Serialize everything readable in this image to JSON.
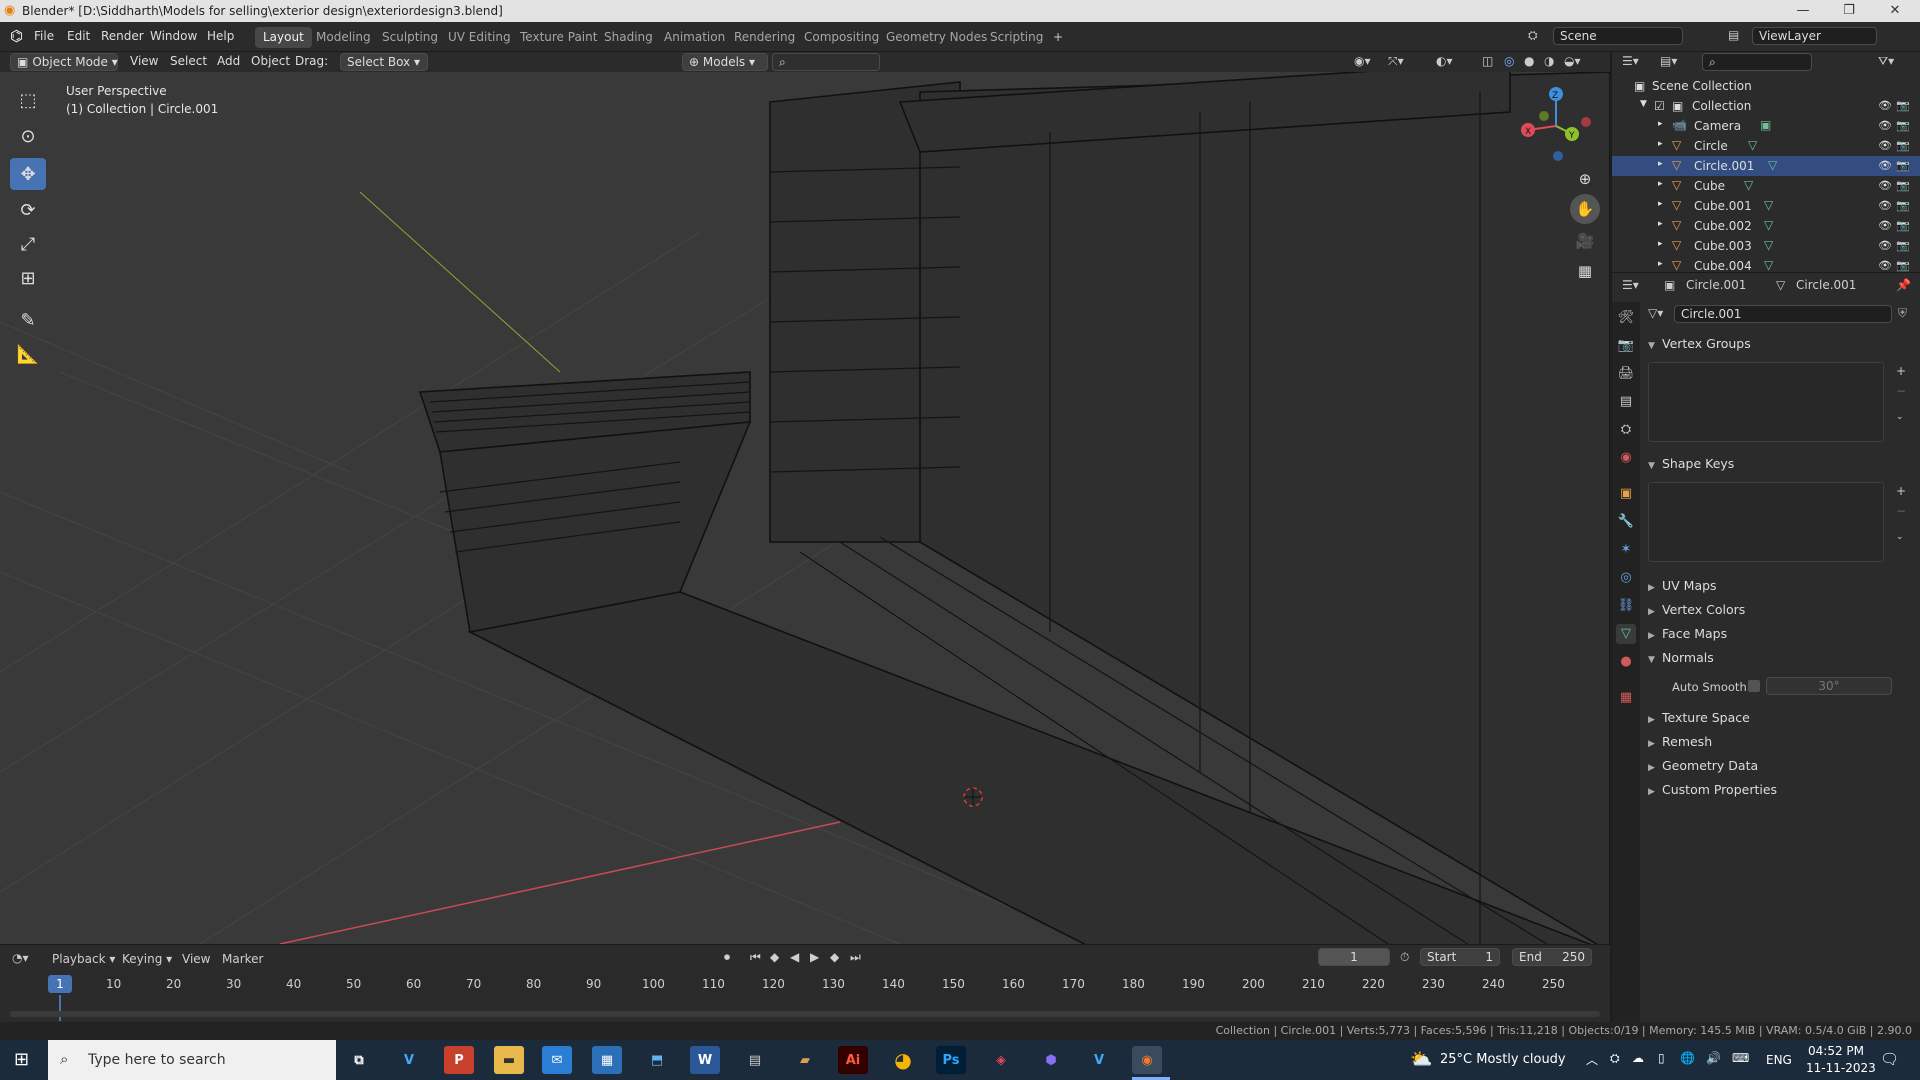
{
  "window": {
    "title": "Blender* [D:\\Siddharth\\Models for selling\\exterior design\\exteriordesign3.blend]",
    "minimize": "—",
    "maximize": "❐",
    "close": "✕"
  },
  "menu": [
    "File",
    "Edit",
    "Render",
    "Window",
    "Help"
  ],
  "workspaces": [
    "Layout",
    "Modeling",
    "Sculpting",
    "UV Editing",
    "Texture Paint",
    "Shading",
    "Animation",
    "Rendering",
    "Compositing",
    "Geometry Nodes",
    "Scripting",
    "+"
  ],
  "scene": {
    "label": "Scene",
    "view_layer": "ViewLayer"
  },
  "header": {
    "mode": "Object Mode",
    "view": "View",
    "select": "Select",
    "add": "Add",
    "object": "Object",
    "drag_label": "Drag:",
    "drag_value": "Select Box",
    "transform": "Models"
  },
  "viewport": {
    "perspective": "User Perspective",
    "collection_info": "(1) Collection | Circle.001"
  },
  "outliner": {
    "root": "Scene Collection",
    "collection": "Collection",
    "items": [
      "Camera",
      "Circle",
      "Circle.001",
      "Cube",
      "Cube.001",
      "Cube.002",
      "Cube.003",
      "Cube.004"
    ],
    "selected": "Circle.001"
  },
  "properties": {
    "object_name": "Circle.001",
    "mesh_name": "Circle.001",
    "data_name": "Circle.001",
    "panels": {
      "vertex_groups": "Vertex Groups",
      "shape_keys": "Shape Keys",
      "uv_maps": "UV Maps",
      "vertex_colors": "Vertex Colors",
      "face_maps": "Face Maps",
      "normals": "Normals",
      "auto_smooth": "Auto Smooth",
      "auto_smooth_angle": "30°",
      "texture_space": "Texture Space",
      "remesh": "Remesh",
      "geometry_data": "Geometry Data",
      "custom_properties": "Custom Properties"
    }
  },
  "timeline": {
    "playback": "Playback",
    "keying": "Keying",
    "view": "View",
    "marker": "Marker",
    "current_frame": "1",
    "start_label": "Start",
    "start": "1",
    "end_label": "End",
    "end": "250",
    "ruler": [
      "10",
      "20",
      "30",
      "40",
      "50",
      "60",
      "70",
      "80",
      "90",
      "100",
      "110",
      "120",
      "130",
      "140",
      "150",
      "160",
      "170",
      "180",
      "190",
      "200",
      "210",
      "220",
      "230",
      "240",
      "250"
    ]
  },
  "statusbar": {
    "text": "Collection | Circle.001 | Verts:5,773 | Faces:5,596 | Tris:11,218 | Objects:0/19 | Memory: 145.5 MiB | VRAM: 0.5/4.0 GiB | 2.90.0"
  },
  "taskbar": {
    "search_placeholder": "Type here to search",
    "weather": "25°C  Mostly cloudy",
    "lang": "ENG",
    "time": "04:52 PM",
    "date": "11-11-2023"
  },
  "colors": {
    "accent": "#4772b3",
    "selected_row": "#334d80",
    "axis_x": "#e04b5a",
    "axis_y": "#8fc12c",
    "axis_z": "#3d8fe0"
  }
}
